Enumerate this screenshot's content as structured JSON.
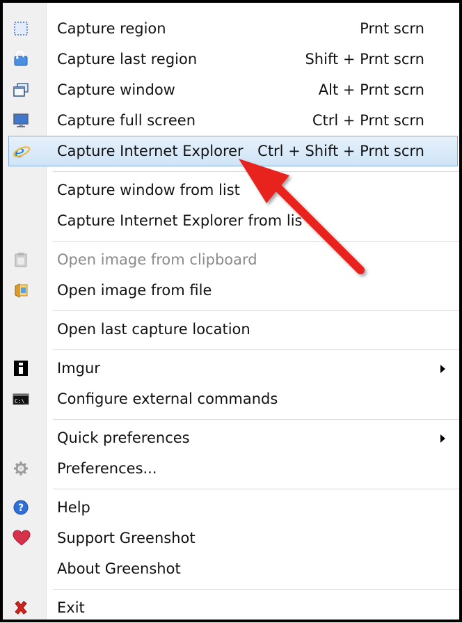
{
  "menu": {
    "items": [
      {
        "id": "capture-region",
        "label": "Capture region",
        "shortcut": "Prnt scrn",
        "icon": "region-select-icon"
      },
      {
        "id": "capture-last-region",
        "label": "Capture last region",
        "shortcut": "Shift + Prnt scrn",
        "icon": "last-region-icon"
      },
      {
        "id": "capture-window",
        "label": "Capture window",
        "shortcut": "Alt + Prnt scrn",
        "icon": "window-icon"
      },
      {
        "id": "capture-full-screen",
        "label": "Capture full screen",
        "shortcut": "Ctrl + Prnt scrn",
        "icon": "monitor-icon"
      },
      {
        "id": "capture-ie",
        "label": "Capture Internet Explorer",
        "shortcut": "Ctrl + Shift + Prnt scrn",
        "icon": "internet-explorer-icon"
      },
      {
        "id": "capture-window-list",
        "label": "Capture window from list"
      },
      {
        "id": "capture-ie-list",
        "label": "Capture Internet Explorer from lis"
      },
      {
        "id": "open-clipboard",
        "label": "Open image from clipboard",
        "icon": "clipboard-icon"
      },
      {
        "id": "open-file",
        "label": "Open image from file",
        "icon": "open-file-icon"
      },
      {
        "id": "open-last-location",
        "label": "Open last capture location"
      },
      {
        "id": "imgur",
        "label": "Imgur",
        "icon": "imgur-icon"
      },
      {
        "id": "external-commands",
        "label": "Configure external commands",
        "icon": "command-prompt-icon"
      },
      {
        "id": "quick-preferences",
        "label": "Quick preferences"
      },
      {
        "id": "preferences",
        "label": "Preferences...",
        "icon": "gear-icon"
      },
      {
        "id": "help",
        "label": "Help",
        "icon": "help-icon"
      },
      {
        "id": "support",
        "label": "Support Greenshot",
        "icon": "heart-icon"
      },
      {
        "id": "about",
        "label": "About Greenshot"
      },
      {
        "id": "exit",
        "label": "Exit",
        "icon": "close-icon"
      }
    ]
  },
  "colors": {
    "highlight": "#cfe4f7",
    "highlight_border": "#84acdd",
    "annotation_arrow": "#e8201c",
    "disabled_text": "#8a8a8a"
  }
}
